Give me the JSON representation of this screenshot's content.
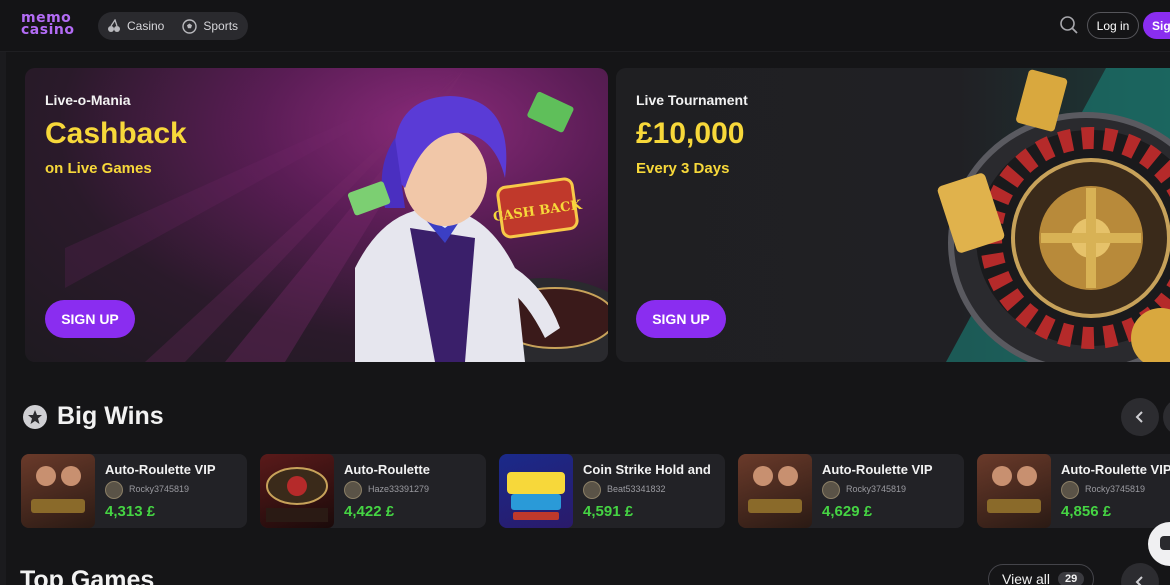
{
  "header": {
    "logo_line1": "memo",
    "logo_line2": "casino",
    "nav": [
      {
        "label": "Casino",
        "icon": "cherries-icon"
      },
      {
        "label": "Sports",
        "icon": "soccer-ball-icon"
      }
    ],
    "login_label": "Log in",
    "signup_label": "Sig"
  },
  "banners": [
    {
      "eyebrow": "Live-o-Mania",
      "headline": "Cashback",
      "sub": "on Live Games",
      "cta": "SIGN UP",
      "art_text": "CASH BACK"
    },
    {
      "eyebrow": "Live Tournament",
      "headline": "£10,000",
      "sub": "Every 3 Days",
      "cta": "SIGN UP"
    }
  ],
  "big_wins": {
    "title": "Big Wins",
    "items": [
      {
        "game": "Auto-Roulette VIP",
        "user": "Rocky3745819",
        "amount": "4,313 £",
        "thumb": "auto-roulette-vip"
      },
      {
        "game": "Auto-Roulette",
        "user": "Haze33391279",
        "amount": "4,422 £",
        "thumb": "auto-roulette"
      },
      {
        "game": "Coin Strike Hold and",
        "user": "Beat53341832",
        "amount": "4,591 £",
        "thumb": "coin-strike"
      },
      {
        "game": "Auto-Roulette VIP",
        "user": "Rocky3745819",
        "amount": "4,629 £",
        "thumb": "auto-roulette-vip"
      },
      {
        "game": "Auto-Roulette VIP",
        "user": "Rocky3745819",
        "amount": "4,856 £",
        "thumb": "auto-roulette-vip"
      }
    ]
  },
  "top_games": {
    "title": "Top Games",
    "view_all_label": "View all",
    "count": "29"
  },
  "colors": {
    "accent": "#8a2df0",
    "headline_yellow": "#f7d83a",
    "win_green": "#45d443",
    "background": "#151517"
  }
}
